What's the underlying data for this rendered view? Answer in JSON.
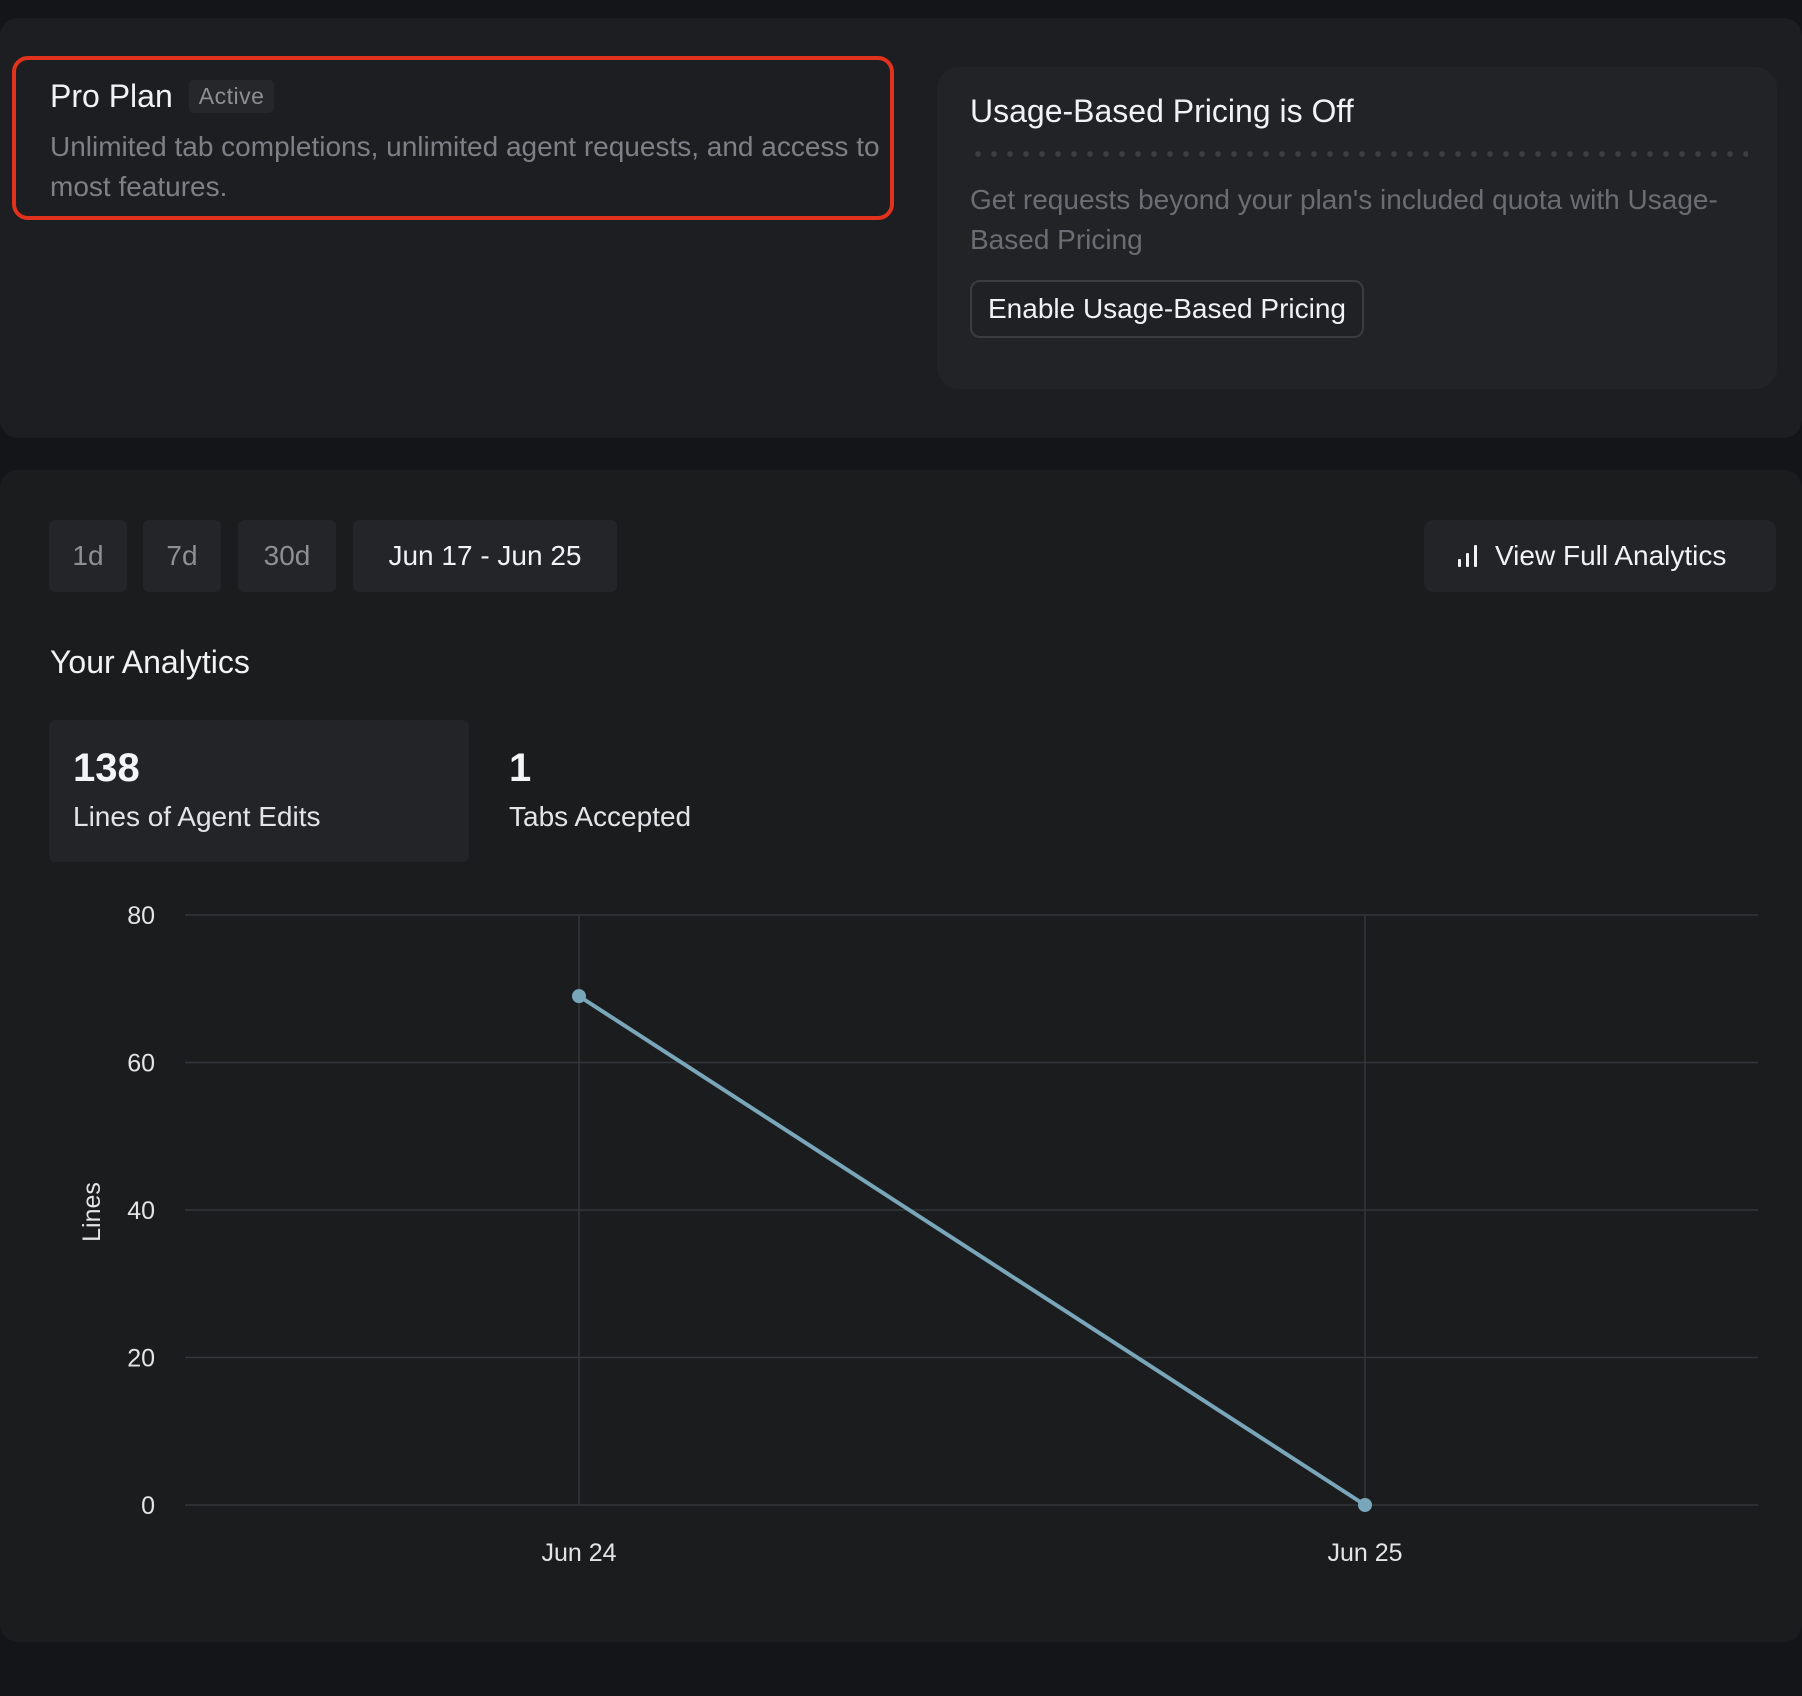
{
  "plan": {
    "title": "Pro Plan",
    "badge": "Active",
    "description": "Unlimited tab completions, unlimited agent requests, and access to most features."
  },
  "usage_pricing": {
    "title": "Usage-Based Pricing is Off",
    "description": "Get requests beyond your plan's included quota with Usage-Based Pricing",
    "button": "Enable Usage-Based Pricing"
  },
  "analytics": {
    "ranges": [
      "1d",
      "7d",
      "30d",
      "Jun 17 - Jun 25"
    ],
    "selected_range": "Jun 17 - Jun 25",
    "view_full": "View Full Analytics",
    "title": "Your Analytics",
    "stats": [
      {
        "value": "138",
        "label": "Lines of Agent Edits"
      },
      {
        "value": "1",
        "label": "Tabs Accepted"
      }
    ]
  },
  "colors": {
    "highlight_border": "#e0321c",
    "series": "#7aa6ba"
  },
  "chart_data": {
    "type": "line",
    "title": "",
    "xlabel": "",
    "ylabel": "Lines",
    "categories": [
      "Jun 24",
      "Jun 25"
    ],
    "series": [
      {
        "values": [
          69,
          0
        ]
      }
    ],
    "ylim": [
      0,
      80
    ],
    "yticks": [
      0,
      20,
      40,
      60,
      80
    ],
    "grid": true
  }
}
